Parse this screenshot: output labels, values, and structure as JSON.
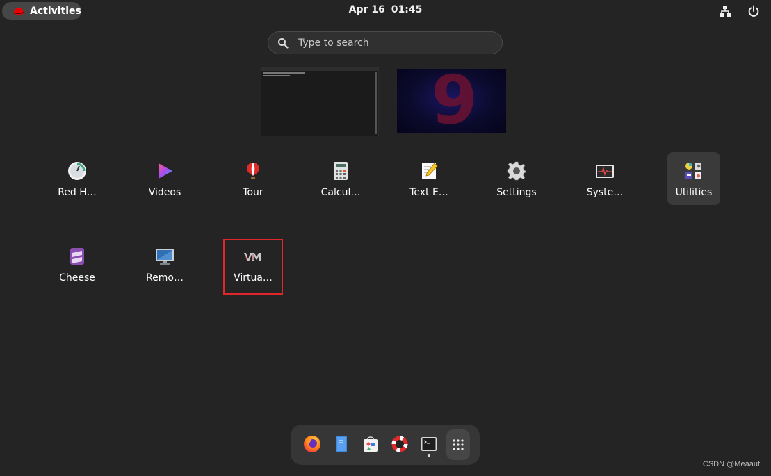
{
  "topbar": {
    "activities_label": "Activities",
    "date": "Apr 16",
    "time": "01:45",
    "icons": [
      "network-icon",
      "power-icon"
    ]
  },
  "search": {
    "placeholder": "Type to search",
    "value": ""
  },
  "workspaces": [
    {
      "name": "terminal-window-thumbnail"
    },
    {
      "name": "desktop-wallpaper-thumbnail",
      "text": "9"
    }
  ],
  "apps": {
    "row1": [
      {
        "label": "Red H…",
        "icon": "red-hat-icon"
      },
      {
        "label": "Videos",
        "icon": "videos-icon"
      },
      {
        "label": "Tour",
        "icon": "tour-icon"
      },
      {
        "label": "Calcul…",
        "icon": "calculator-icon"
      },
      {
        "label": "Text E…",
        "icon": "text-editor-icon"
      },
      {
        "label": "Settings",
        "icon": "gear-icon"
      },
      {
        "label": "Syste…",
        "icon": "system-monitor-icon"
      },
      {
        "label": "Utilities",
        "icon": "utilities-folder-icon"
      }
    ],
    "row2": [
      {
        "label": "Cheese",
        "icon": "cheese-icon"
      },
      {
        "label": "Remo…",
        "icon": "remote-desktop-icon"
      },
      {
        "label": "Virtua…",
        "icon": "virtual-machine-manager-icon"
      }
    ]
  },
  "dash": {
    "items": [
      "firefox-icon",
      "files-icon",
      "software-icon",
      "help-icon",
      "terminal-icon",
      "app-grid-icon"
    ]
  },
  "colors": {
    "background": "#242424",
    "highlight_border": "#e0262b",
    "selected_tile": "#3a3a3a"
  },
  "watermark": "CSDN @Meaauf"
}
